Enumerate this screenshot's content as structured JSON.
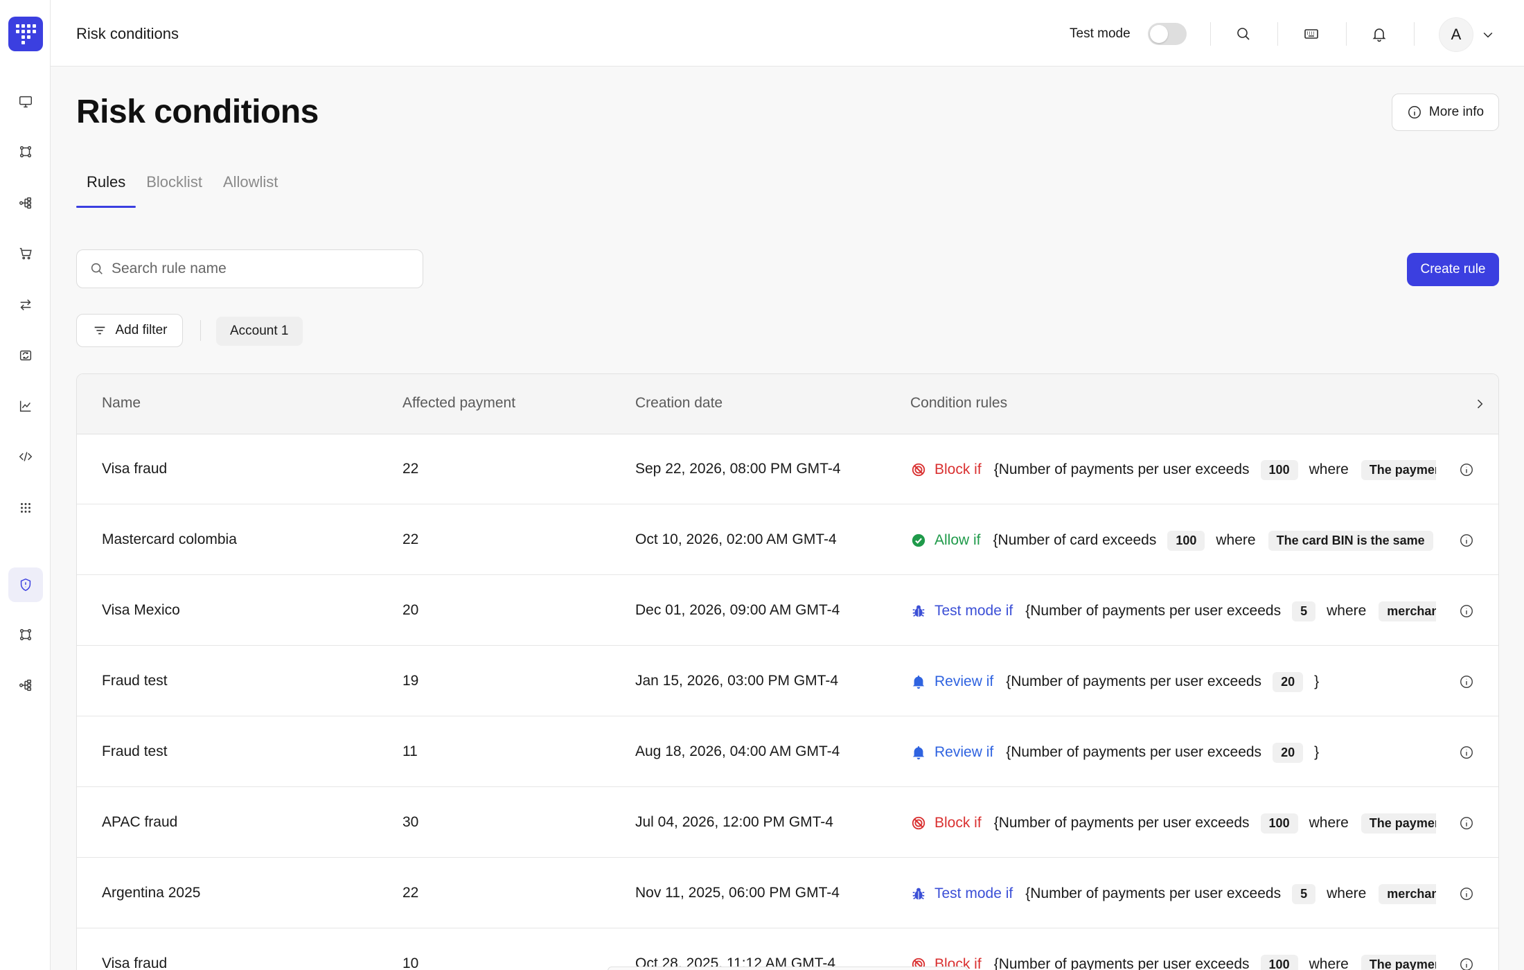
{
  "topbar": {
    "title": "Risk conditions",
    "test_mode_label": "Test mode",
    "avatar_initial": "A"
  },
  "page": {
    "title": "Risk conditions",
    "more_info_label": "More info"
  },
  "tabs": [
    "Rules",
    "Blocklist",
    "Allowlist"
  ],
  "search": {
    "placeholder": "Search rule name"
  },
  "create_rule_label": "Create rule",
  "filters": {
    "add_filter_label": "Add filter",
    "account_chip": "Account 1"
  },
  "table": {
    "columns": [
      "Name",
      "Affected payment",
      "Creation date",
      "Condition rules"
    ],
    "rows": [
      {
        "name": "Visa fraud",
        "affected": "22",
        "date": "Sep 22, 2026, 08:00 PM GMT-4",
        "action": "Block if",
        "kind": "block",
        "condition": "{Number of payments per user exceeds",
        "value": "100",
        "where": "where",
        "detail": "The payment"
      },
      {
        "name": "Mastercard colombia",
        "affected": "22",
        "date": "Oct 10, 2026, 02:00 AM GMT-4",
        "action": "Allow if",
        "kind": "allow",
        "condition": "{Number of card exceeds",
        "value": "100",
        "where": "where",
        "detail": "The card BIN is the same"
      },
      {
        "name": "Visa Mexico",
        "affected": "20",
        "date": "Dec 01, 2026, 09:00 AM GMT-4",
        "action": "Test mode if",
        "kind": "test",
        "condition": "{Number of payments per user exceeds",
        "value": "5",
        "where": "where",
        "detail": "merchant"
      },
      {
        "name": "Fraud test",
        "affected": "19",
        "date": "Jan 15, 2026, 03:00 PM GMT-4",
        "action": "Review if",
        "kind": "review",
        "condition": "{Number of payments per user exceeds",
        "value": "20",
        "where": "}",
        "detail": ""
      },
      {
        "name": "Fraud test",
        "affected": "11",
        "date": "Aug 18, 2026, 04:00 AM GMT-4",
        "action": "Review if",
        "kind": "review",
        "condition": "{Number of payments per user exceeds",
        "value": "20",
        "where": "}",
        "detail": ""
      },
      {
        "name": "APAC fraud",
        "affected": "30",
        "date": "Jul 04, 2026, 12:00 PM GMT-4",
        "action": "Block if",
        "kind": "block",
        "condition": "{Number of payments per user exceeds",
        "value": "100",
        "where": "where",
        "detail": "The payment"
      },
      {
        "name": "Argentina 2025",
        "affected": "22",
        "date": "Nov 11, 2025, 06:00 PM GMT-4",
        "action": "Test mode if",
        "kind": "test",
        "condition": "{Number of payments per user exceeds",
        "value": "5",
        "where": "where",
        "detail": "merchant"
      },
      {
        "name": "Visa fraud",
        "affected": "10",
        "date": "Oct 28, 2025, 11:12 AM GMT-4",
        "action": "Block if",
        "kind": "block",
        "condition": "{Number of payments per user exceeds",
        "value": "100",
        "where": "where",
        "detail": "The payment"
      }
    ]
  },
  "colors": {
    "accent": "#3b3fe0",
    "block": "#d93030",
    "allow": "#1f9a4a",
    "test": "#3b4fd6",
    "review": "#2f63e0"
  }
}
